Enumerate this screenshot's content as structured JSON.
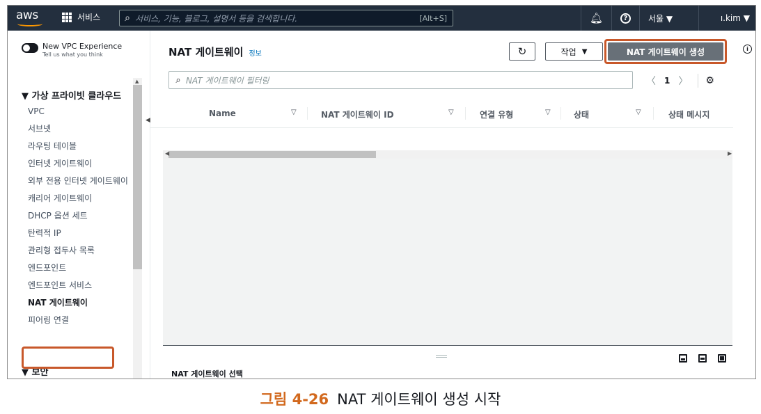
{
  "topnav": {
    "logo_text": "aws",
    "services_label": "서비스",
    "search_placeholder": "서비스, 기능, 블로그, 설명서 등을 검색합니다.",
    "search_shortcut": "[Alt+S]",
    "region_label": "서울 ▼",
    "user_label": "ı.kim ▼"
  },
  "sidebar": {
    "toggle_title": "New VPC Experience",
    "toggle_subtitle": "Tell us what you think",
    "section_vpc": "▼ 가상 프라이빗 클라우드",
    "items": [
      {
        "label": "VPC"
      },
      {
        "label": "서브넷"
      },
      {
        "label": "라우팅 테이블"
      },
      {
        "label": "인터넷 게이트웨이"
      },
      {
        "label": "외부 전용 인터넷 게이트웨이"
      },
      {
        "label": "캐리어 게이트웨이"
      },
      {
        "label": "DHCP 옵션 세트"
      },
      {
        "label": "탄력적 IP"
      },
      {
        "label": "관리형 접두사 목록"
      },
      {
        "label": "엔드포인트"
      },
      {
        "label": "엔드포인트 서비스"
      },
      {
        "label": "NAT 게이트웨이"
      },
      {
        "label": "피어링 연결"
      }
    ],
    "section_security": "▼ 보안"
  },
  "main": {
    "title": "NAT 게이트웨이",
    "info_link": "정보",
    "action_label": "작업",
    "create_label": "NAT 게이트웨이 생성",
    "filter_placeholder": "NAT 게이트웨이 필터링",
    "page_number": "1",
    "columns": [
      "Name",
      "NAT 게이트웨이 ID",
      "연결 유형",
      "상태",
      "상태 메시지"
    ],
    "split_title": "NAT 게이트웨이 선택"
  },
  "caption": {
    "number": "그림 4-26",
    "text": "NAT 게이트웨이 생성 시작"
  },
  "colors": {
    "nav_bg": "#232f3e",
    "highlight": "#c8582a",
    "primary_btn": "#687078"
  }
}
